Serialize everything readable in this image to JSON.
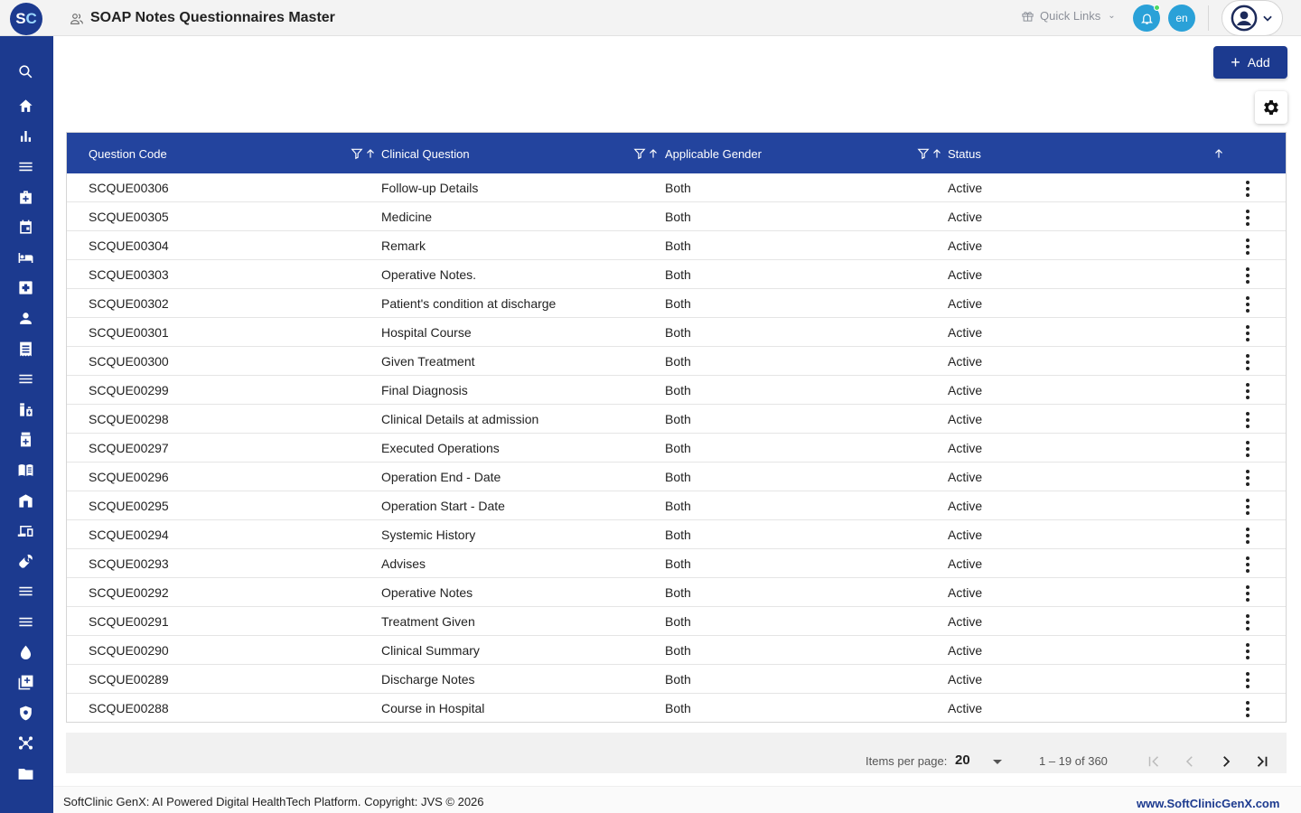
{
  "app": {
    "logo_text_s": "S",
    "logo_text_c": "C",
    "page_title": "SOAP Notes Questionnaires Master"
  },
  "header": {
    "quick_links": "Quick Links",
    "language": "en"
  },
  "toolbar": {
    "add_label": "Add"
  },
  "table": {
    "columns": [
      "Question Code",
      "Clinical Question",
      "Applicable Gender",
      "Status"
    ],
    "rows": [
      {
        "code": "SCQUE00306",
        "question": "Follow-up Details",
        "gender": "Both",
        "status": "Active"
      },
      {
        "code": "SCQUE00305",
        "question": "Medicine",
        "gender": "Both",
        "status": "Active"
      },
      {
        "code": "SCQUE00304",
        "question": "Remark",
        "gender": "Both",
        "status": "Active"
      },
      {
        "code": "SCQUE00303",
        "question": "Operative Notes.",
        "gender": "Both",
        "status": "Active"
      },
      {
        "code": "SCQUE00302",
        "question": "Patient's condition at discharge",
        "gender": "Both",
        "status": "Active"
      },
      {
        "code": "SCQUE00301",
        "question": "Hospital Course",
        "gender": "Both",
        "status": "Active"
      },
      {
        "code": "SCQUE00300",
        "question": "Given Treatment",
        "gender": "Both",
        "status": "Active"
      },
      {
        "code": "SCQUE00299",
        "question": "Final Diagnosis",
        "gender": "Both",
        "status": "Active"
      },
      {
        "code": "SCQUE00298",
        "question": "Clinical Details at admission",
        "gender": "Both",
        "status": "Active"
      },
      {
        "code": "SCQUE00297",
        "question": "Executed Operations",
        "gender": "Both",
        "status": "Active"
      },
      {
        "code": "SCQUE00296",
        "question": "Operation End - Date",
        "gender": "Both",
        "status": "Active"
      },
      {
        "code": "SCQUE00295",
        "question": "Operation Start - Date",
        "gender": "Both",
        "status": "Active"
      },
      {
        "code": "SCQUE00294",
        "question": "Systemic History",
        "gender": "Both",
        "status": "Active"
      },
      {
        "code": "SCQUE00293",
        "question": "Advises",
        "gender": "Both",
        "status": "Active"
      },
      {
        "code": "SCQUE00292",
        "question": "Operative Notes",
        "gender": "Both",
        "status": "Active"
      },
      {
        "code": "SCQUE00291",
        "question": "Treatment Given",
        "gender": "Both",
        "status": "Active"
      },
      {
        "code": "SCQUE00290",
        "question": "Clinical Summary",
        "gender": "Both",
        "status": "Active"
      },
      {
        "code": "SCQUE00289",
        "question": "Discharge Notes",
        "gender": "Both",
        "status": "Active"
      },
      {
        "code": "SCQUE00288",
        "question": "Course in Hospital",
        "gender": "Both",
        "status": "Active"
      }
    ]
  },
  "pagination": {
    "items_per_page_label": "Items per page:",
    "items_per_page_value": "20",
    "range_label": "1 – 19 of 360"
  },
  "footer": {
    "copyright": "SoftClinic GenX: AI Powered Digital HealthTech Platform. Copyright: JVS © 2026",
    "site": "www.SoftClinicGenX.com"
  },
  "sidebar": {
    "icons": [
      "search-icon",
      "home-icon",
      "bar-chart-icon",
      "menu-icon",
      "medical-bag-icon",
      "calendar-icon",
      "bed-icon",
      "medical-plus-icon",
      "person-icon",
      "receipt-icon",
      "list-icon",
      "pharmacy-icon",
      "medicine-box-icon",
      "book-icon",
      "store-icon",
      "devices-icon",
      "wrench-icon",
      "lines-icon",
      "menu-lines-icon",
      "drop-icon",
      "add-library-icon",
      "shield-icon",
      "network-icon",
      "folder-icon"
    ]
  },
  "colors": {
    "brand": "#1c3a8f",
    "table_header": "#23449e",
    "accent_circle": "#2aa1d8"
  }
}
